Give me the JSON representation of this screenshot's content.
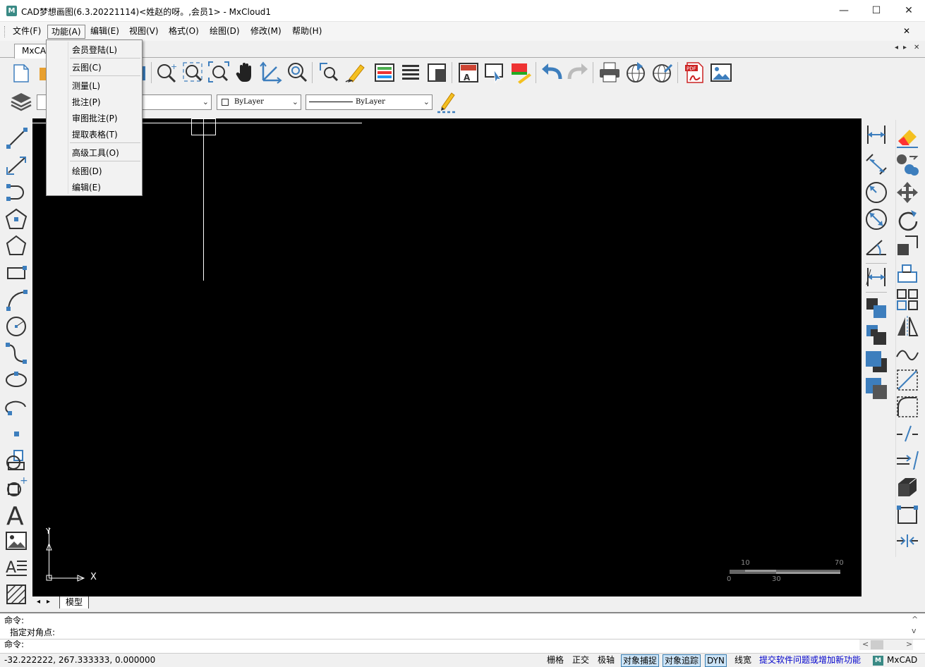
{
  "window": {
    "title": "CAD梦想画图(6.3.20221114)<姓赵的呀。,会员1> - MxCloud1",
    "app_icon": "M",
    "controls": {
      "minimize": "—",
      "maximize": "☐",
      "close": "✕"
    }
  },
  "menubar": {
    "items": [
      "文件(F)",
      "功能(A)",
      "编辑(E)",
      "视图(V)",
      "格式(O)",
      "绘图(D)",
      "修改(M)",
      "帮助(H)"
    ],
    "active": "功能(A)",
    "close_glyph": "✕"
  },
  "dropdown": {
    "items": [
      "会员登陆(L)",
      "云图(C)",
      "测量(L)",
      "批注(P)",
      "审图批注(P)",
      "提取表格(T)",
      "高级工具(O)",
      "绘图(D)",
      "编辑(E)"
    ]
  },
  "document_tab": {
    "label": "MxCA",
    "nav_left": "◂",
    "nav_right": "▸",
    "close": "✕"
  },
  "properties": {
    "color_combo": "ByLayer",
    "linetype_combo": "ByLayer"
  },
  "layout_tabs": {
    "model": "模型",
    "nav_left": "◂",
    "nav_right": "▸"
  },
  "canvas": {
    "ucs_y": "Y",
    "ucs_x": "X",
    "scale_bar": {
      "top_labels": [
        "10",
        "70"
      ],
      "bottom_labels": [
        "0",
        "30"
      ]
    }
  },
  "command": {
    "lines": [
      "命令:",
      "指定对角点:"
    ],
    "prompt": "命令:",
    "scroll_up": "^",
    "scroll_down": "v",
    "hscroll_left": "<",
    "hscroll_right": ">"
  },
  "statusbar": {
    "coords": "-32.222222,  267.333333,  0.000000",
    "toggles": [
      {
        "label": "栅格",
        "on": false
      },
      {
        "label": "正交",
        "on": false
      },
      {
        "label": "极轴",
        "on": false
      },
      {
        "label": "对象捕捉",
        "on": true
      },
      {
        "label": "对象追踪",
        "on": true
      },
      {
        "label": "DYN",
        "on": true
      },
      {
        "label": "线宽",
        "on": false
      }
    ],
    "feedback_link": "提交软件问题或增加新功能",
    "brand": "MxCAD"
  },
  "colors": {
    "accent_blue": "#3d7ebd",
    "canvas": "#000000",
    "link": "#0000cc"
  }
}
